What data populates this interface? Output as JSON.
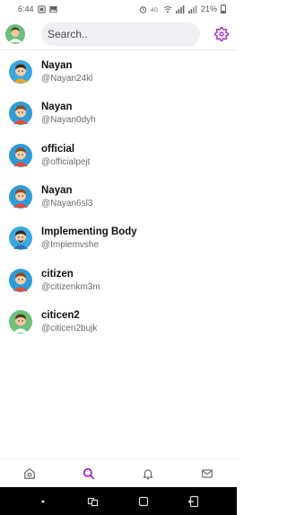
{
  "status_bar": {
    "time": "6:44",
    "battery": "21%"
  },
  "search": {
    "placeholder": "Search.."
  },
  "colors": {
    "accent": "#a020c8",
    "avatar_bg": "#2e9bd6",
    "avatar_bg_alt": "#3ba7e0"
  },
  "users": [
    {
      "name": "Nayan",
      "handle": "@Nayan24kl",
      "avatar": "boy-avatar-icon"
    },
    {
      "name": "Nayan",
      "handle": "@Nayan0dyh",
      "avatar": "boy-avatar-icon"
    },
    {
      "name": "official",
      "handle": "@officialpejt",
      "avatar": "boy-avatar-icon"
    },
    {
      "name": "Nayan",
      "handle": "@Nayan6sl3",
      "avatar": "boy-avatar-icon"
    },
    {
      "name": "Implementing Body",
      "handle": "@Implemvshe",
      "avatar": "man-avatar-icon"
    },
    {
      "name": "citizen",
      "handle": "@citizenkm3m",
      "avatar": "boy-avatar-icon"
    },
    {
      "name": "citicen2",
      "handle": "@citicen2bujk",
      "avatar": "green-avatar-icon"
    }
  ],
  "bottom_nav": [
    {
      "icon": "home-icon",
      "active": false
    },
    {
      "icon": "search-icon",
      "active": true
    },
    {
      "icon": "bell-icon",
      "active": false
    },
    {
      "icon": "mail-icon",
      "active": false
    }
  ]
}
